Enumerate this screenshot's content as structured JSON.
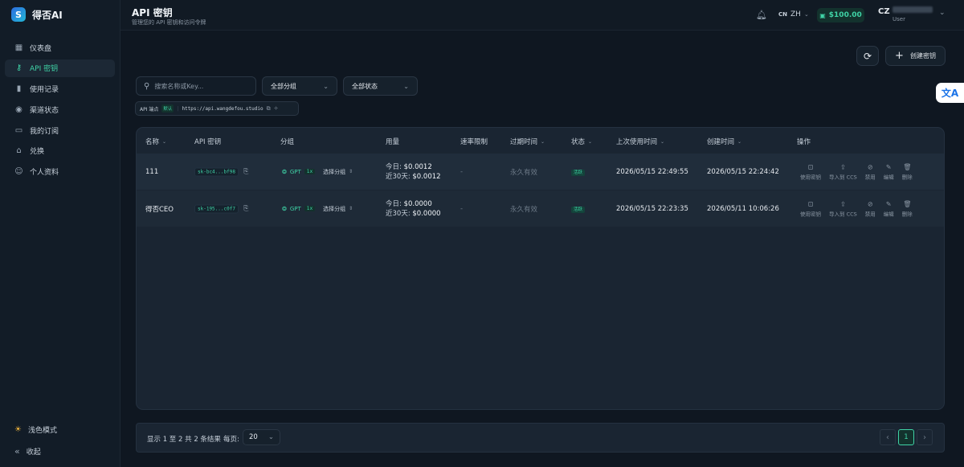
{
  "brand": {
    "logo_letter": "S",
    "name": "得否AI"
  },
  "sidebar": {
    "items": [
      {
        "label": "仪表盘",
        "icon": "grid-icon",
        "glyph": "▦"
      },
      {
        "label": "API 密钥",
        "icon": "key-icon",
        "glyph": "⚷"
      },
      {
        "label": "使用记录",
        "icon": "bar-chart-icon",
        "glyph": "▮"
      },
      {
        "label": "渠道状态",
        "icon": "signal-icon",
        "glyph": "◉"
      },
      {
        "label": "我的订阅",
        "icon": "card-icon",
        "glyph": "▭"
      },
      {
        "label": "兑换",
        "icon": "gift-icon",
        "glyph": "⌂"
      },
      {
        "label": "个人资料",
        "icon": "user-icon",
        "glyph": "☺"
      }
    ],
    "theme_label": "浅色模式",
    "collapse_label": "收起"
  },
  "header": {
    "title": "API 密钥",
    "subtitle": "管理您的 API 密钥和访问令牌",
    "lang_code": "CN",
    "lang": "ZH",
    "balance": "$100.00",
    "avatar_initials": "CZ",
    "user_role": "User"
  },
  "toolbar": {
    "create_label": "创建密钥"
  },
  "filters": {
    "search_placeholder": "搜索名称或Key...",
    "group_select": "全部分组",
    "status_select": "全部状态"
  },
  "endpoint": {
    "label": "API 端点",
    "badge": "默认",
    "url": "https://api.wangdefou.studio"
  },
  "table": {
    "columns": [
      "名称",
      "API 密钥",
      "分组",
      "用量",
      "速率限制",
      "过期时间",
      "状态",
      "上次使用时间",
      "创建时间",
      "操作"
    ],
    "rows": [
      {
        "name": "111",
        "key": "sk-bc4...bf98",
        "group": "GPT",
        "multiplier": "1x",
        "group_pick": "选择分组",
        "today_label": "今日:",
        "today": "$0.0012",
        "month_label": "近30天:",
        "month": "$0.0012",
        "rate_limit": "-",
        "expiry": "永久有效",
        "status": "活跃",
        "last_used": "2026/05/15 22:49:55",
        "created": "2026/05/15 22:24:42"
      },
      {
        "name": "得否CEO",
        "key": "sk-195...c0f7",
        "group": "GPT",
        "multiplier": "1x",
        "group_pick": "选择分组",
        "today_label": "今日:",
        "today": "$0.0000",
        "month_label": "近30天:",
        "month": "$0.0000",
        "rate_limit": "-",
        "expiry": "永久有效",
        "status": "活跃",
        "last_used": "2026/05/15 22:23:35",
        "created": "2026/05/11 10:06:26"
      }
    ],
    "actions": [
      "使用密钥",
      "导入到 CCS",
      "禁用",
      "编辑",
      "删除"
    ]
  },
  "pagination": {
    "summary": "显示 1 至 2 共 2 条结果",
    "per_page_label": "每页:",
    "per_page": "20",
    "current_page": "1"
  },
  "translate_glyph": "文A",
  "colors": {
    "accent": "#3fd3a6",
    "background": "#0f1721",
    "panel": "#1a2532"
  }
}
